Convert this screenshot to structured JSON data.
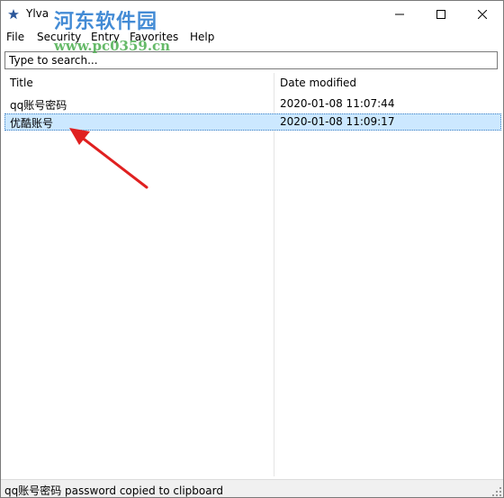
{
  "window": {
    "title": "Ylva",
    "watermark_text": "河东软件园",
    "watermark_url": "www.pc0359.cn"
  },
  "menu": {
    "file": "File",
    "security": "Security",
    "entry": "Entry",
    "favorites": "Favorites",
    "help": "Help"
  },
  "search": {
    "placeholder": "Type to search..."
  },
  "table": {
    "headers": {
      "title": "Title",
      "date_modified": "Date modified"
    },
    "rows": [
      {
        "title": "qq账号密码",
        "date": "2020-01-08 11:07:44",
        "selected": false
      },
      {
        "title": "优酷账号",
        "date": "2020-01-08 11:09:17",
        "selected": true
      }
    ]
  },
  "status": {
    "text": "qq账号密码 password copied to clipboard"
  },
  "colors": {
    "selection": "#cce8ff",
    "annotation_arrow": "#e02020",
    "watermark": "#2f7fd1"
  }
}
